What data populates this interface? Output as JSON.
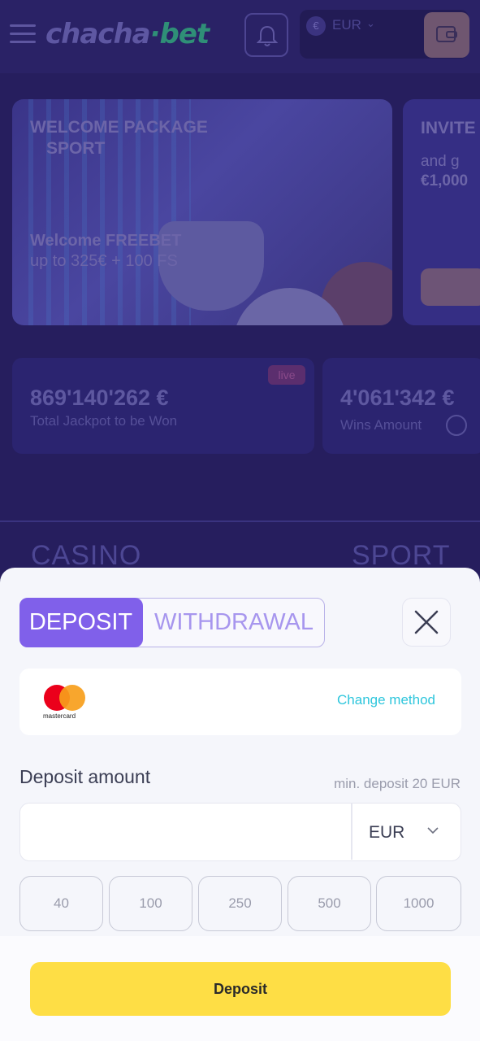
{
  "app": {
    "logo": {
      "part1": "chacha",
      "dot": "·",
      "part2": "bet"
    },
    "currency": {
      "symbol": "€",
      "code": "EUR"
    },
    "banner": {
      "title_line1": "WELCOME PACKAGE",
      "title_line2": "SPORT",
      "subtitle_line1": "Welcome FREEBET",
      "subtitle_line2": "up to 325€ + 100 FS"
    },
    "banner2": {
      "title": "INVITE",
      "line1": "and g",
      "line2": "€1,000"
    },
    "jackpot": {
      "amount": "869'140'262 €",
      "label": "Total Jackpot to be Won",
      "badge": "live"
    },
    "wins": {
      "amount": "4'061'342 €",
      "label": "Wins Amount"
    },
    "sections": {
      "casino": "CASINO",
      "sport": "SPORT"
    }
  },
  "sheet": {
    "tabs": {
      "deposit": "DEPOSIT",
      "withdrawal": "WITHDRAWAL"
    },
    "active_tab": "deposit",
    "method": {
      "brand": "mastercard",
      "change_label": "Change method"
    },
    "amount_label": "Deposit amount",
    "min_deposit": "min. deposit 20 EUR",
    "amount_value": "",
    "currency_selected": "EUR",
    "presets": [
      "40",
      "100",
      "250",
      "500",
      "1000"
    ],
    "submit_label": "Deposit",
    "colors": {
      "accent": "#8060ea",
      "button": "#fede45",
      "link": "#2ec6dc"
    }
  }
}
